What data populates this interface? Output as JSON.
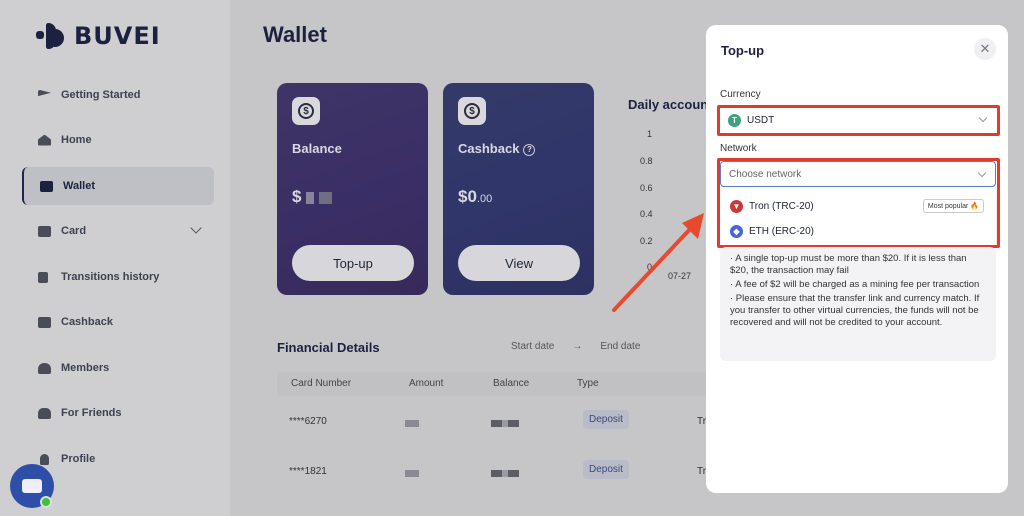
{
  "brand": {
    "name": "BUVEI"
  },
  "sidebar": {
    "items": [
      {
        "label": "Getting Started"
      },
      {
        "label": "Home"
      },
      {
        "label": "Wallet"
      },
      {
        "label": "Card"
      },
      {
        "label": "Transitions history"
      },
      {
        "label": "Cashback"
      },
      {
        "label": "Members"
      },
      {
        "label": "For Friends"
      },
      {
        "label": "Profile"
      }
    ]
  },
  "page": {
    "title": "Wallet"
  },
  "balance_card": {
    "label": "Balance",
    "currency_symbol": "$",
    "button": "Top-up"
  },
  "cashback_card": {
    "label": "Cashback",
    "value_main": "$0",
    "value_decimal": ".00",
    "button": "View"
  },
  "daily": {
    "title": "Daily account",
    "ticks": [
      "1",
      "0.8",
      "0.6",
      "0.4",
      "0.2",
      "0"
    ],
    "x_label": "07-27"
  },
  "financial": {
    "title": "Financial Details",
    "start_date": "Start date",
    "arrow": "→",
    "end_date": "End date",
    "columns": [
      "Card Number",
      "Amount",
      "Balance",
      "Type"
    ],
    "rows": [
      {
        "card": "****6270",
        "type": "Deposit",
        "extra": "Tr"
      },
      {
        "card": "****1821",
        "type": "Deposit",
        "extra": "Tr"
      }
    ]
  },
  "modal": {
    "title": "Top-up",
    "close": "✕",
    "currency_label": "Currency",
    "currency_value": "USDT",
    "network_label": "Network",
    "network_placeholder": "Choose network",
    "options": [
      {
        "label": "Tron (TRC-20)",
        "badge": "Most popular 🔥"
      },
      {
        "label": "ETH (ERC-20)"
      }
    ],
    "notes": [
      "· A single top-up must be more than $20. If it is less than $20, the transaction may fail",
      "· A fee of $2 will be charged as a mining fee per transaction",
      "· Please ensure that the transfer link and currency match. If you transfer to other virtual currencies, the funds will not be recovered and will not be credited to your account."
    ]
  },
  "colors": {
    "highlight": "#e23b2e",
    "accent": "#1c2140"
  }
}
